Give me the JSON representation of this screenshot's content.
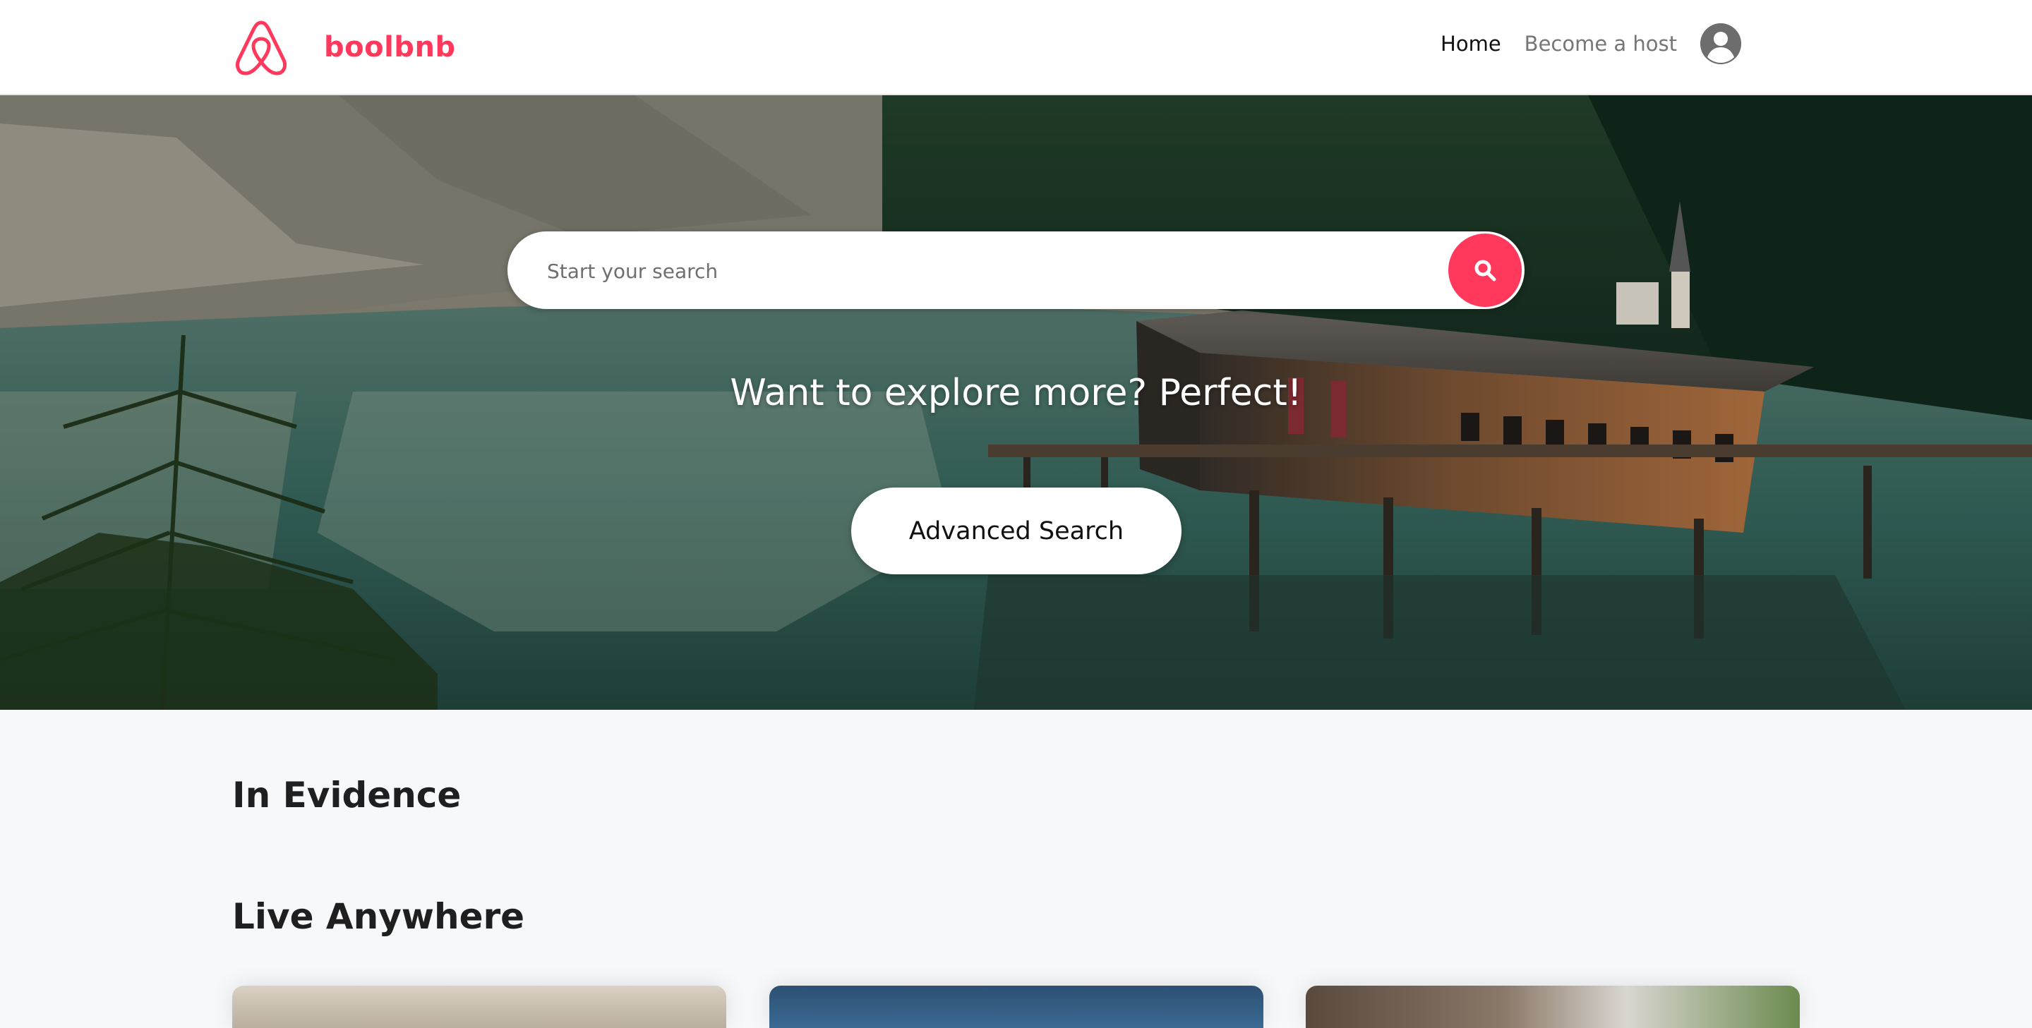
{
  "navbar": {
    "brand_name": "boolbnb",
    "links": [
      {
        "label": "Home",
        "active": true
      },
      {
        "label": "Become a host",
        "active": false
      }
    ],
    "avatar_icon": "user-circle-icon",
    "brand_icon": "airbnb-logo-icon"
  },
  "hero": {
    "search": {
      "placeholder": "Start your search",
      "value": "",
      "button_icon": "search-icon"
    },
    "heading": "Want to explore more? Perfect!",
    "advanced_search_label": "Advanced Search"
  },
  "sections": {
    "in_evidence_title": "In Evidence",
    "live_anywhere_title": "Live Anywhere"
  },
  "colors": {
    "brand": "#ff385c",
    "page_background": "#f7f8fa",
    "nav_background": "#ffffff"
  }
}
